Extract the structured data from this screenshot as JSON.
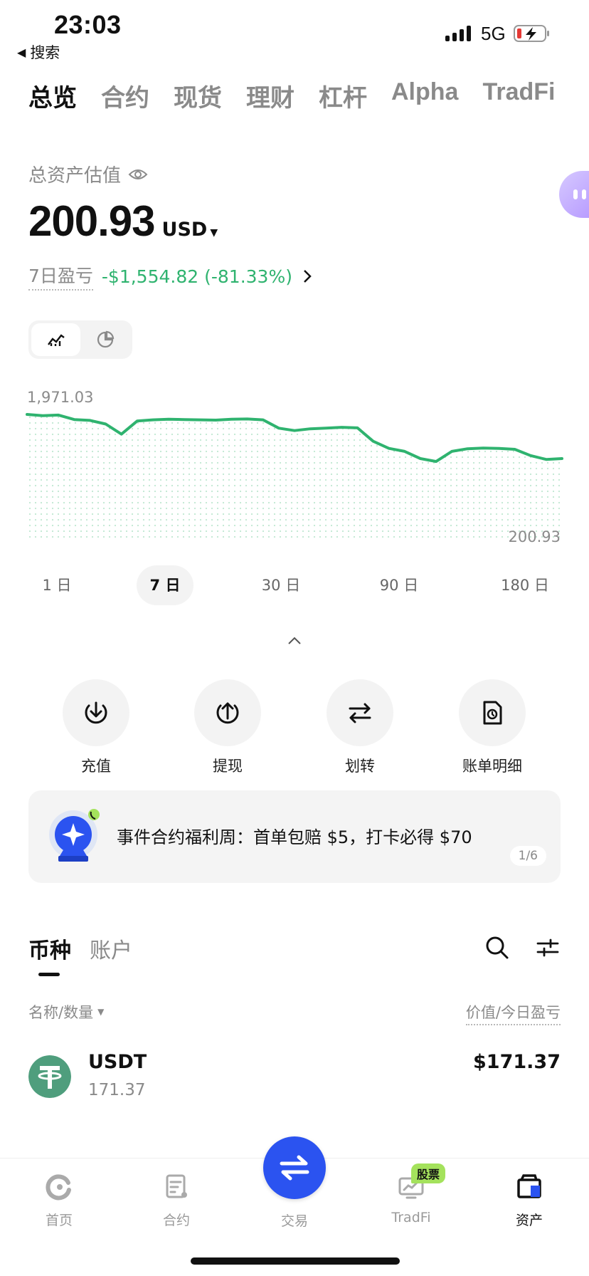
{
  "status_bar": {
    "time": "23:03",
    "back_label": "搜索",
    "network": "5G"
  },
  "top_tabs": [
    {
      "label": "总览"
    },
    {
      "label": "合约"
    },
    {
      "label": "现货"
    },
    {
      "label": "理财"
    },
    {
      "label": "杠杆"
    },
    {
      "label": "Alpha"
    },
    {
      "label": "TradFi"
    }
  ],
  "overview": {
    "label": "总资产估值",
    "value": "200.93",
    "currency": "USD",
    "pnl_label": "7日盈亏",
    "pnl_value": "-$1,554.82 (-81.33%)"
  },
  "chart_data": {
    "type": "area",
    "max_label": "1,971.03",
    "min_label": "200.93",
    "ylim": [
      200.93,
      1971.03
    ],
    "color": "#2fb36f",
    "values": [
      1971.03,
      1950,
      1960,
      1885,
      1870,
      1810,
      1640,
      1860,
      1880,
      1890,
      1885,
      1880,
      1875,
      1890,
      1895,
      1880,
      1740,
      1700,
      1730,
      1740,
      1755,
      1745,
      1520,
      1400,
      1350,
      1230,
      1180,
      1350,
      1395,
      1405,
      1400,
      1385,
      1280,
      1215,
      1230
    ]
  },
  "range_tabs": [
    {
      "label": "1 日"
    },
    {
      "label": "7 日"
    },
    {
      "label": "30 日"
    },
    {
      "label": "90 日"
    },
    {
      "label": "180 日"
    }
  ],
  "actions": [
    {
      "label": "充值"
    },
    {
      "label": "提现"
    },
    {
      "label": "划转"
    },
    {
      "label": "账单明细"
    }
  ],
  "banner": {
    "text": "事件合约福利周：首单包赔 $5，打卡必得 $70",
    "page": "1/6"
  },
  "coin_tabs": [
    {
      "label": "币种"
    },
    {
      "label": "账户"
    }
  ],
  "list_header": {
    "left": "名称/数量",
    "right": "价值/今日盈亏"
  },
  "coins": [
    {
      "symbol": "USDT",
      "quantity": "171.37",
      "value": "$171.37"
    }
  ],
  "bottom_nav": {
    "home": "首页",
    "futures": "合约",
    "trade": "交易",
    "tradfi": "TradFi",
    "assets": "资产",
    "stock_badge": "股票"
  }
}
